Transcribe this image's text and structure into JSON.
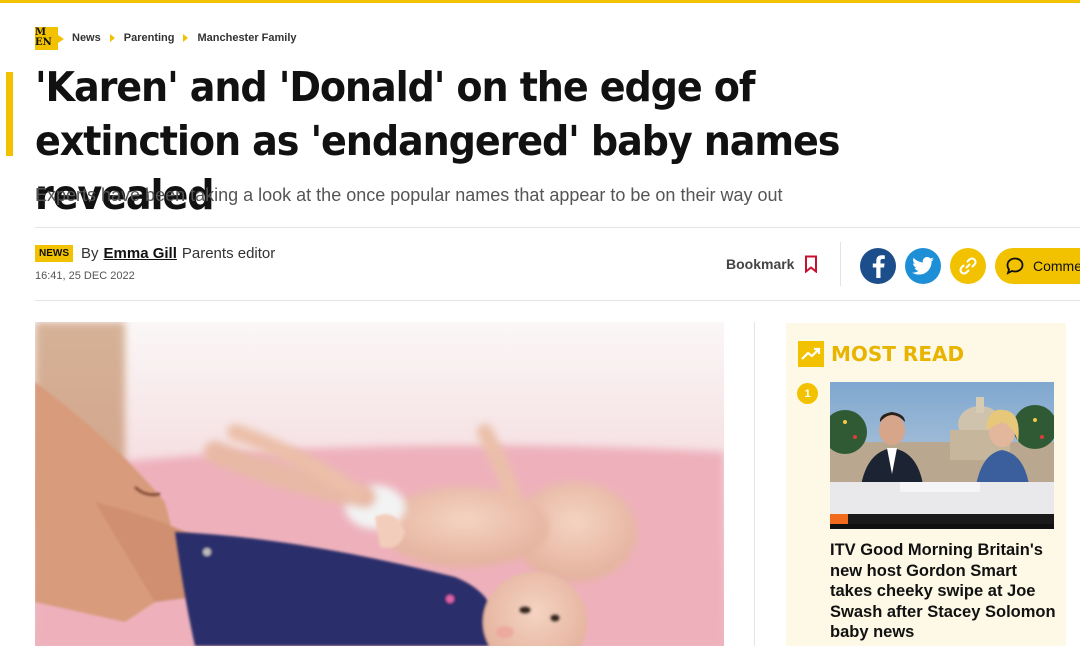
{
  "breadcrumb": {
    "logo_text": "M EN",
    "items": [
      "News",
      "Parenting",
      "Manchester Family"
    ]
  },
  "article": {
    "headline": "'Karen' and 'Donald' on the edge of extinction as 'endangered' baby names revealed",
    "standfirst": "Experts have been taking a look at the once popular names that appear to be on their way out",
    "badge": "NEWS",
    "by": "By",
    "author": "Emma Gill",
    "author_role": "Parents editor",
    "date": "16:41, 25 DEC 2022"
  },
  "actions": {
    "bookmark_label": "Bookmark",
    "comment_label": "Comments",
    "icons": [
      "facebook-icon",
      "twitter-icon",
      "link-icon",
      "comment-icon",
      "bookmark-icon"
    ]
  },
  "most_read": {
    "title": "MOST READ",
    "items": [
      {
        "rank": "1",
        "headline": "ITV Good Morning Britain's new host Gordon Smart takes cheeky swipe at Joe Swash after Stacey Solomon baby news"
      }
    ]
  },
  "colors": {
    "accent": "#f2c200",
    "facebook": "#1d4e8c",
    "twitter": "#1d8fd6",
    "most_read_bg": "#fdf9e6"
  }
}
